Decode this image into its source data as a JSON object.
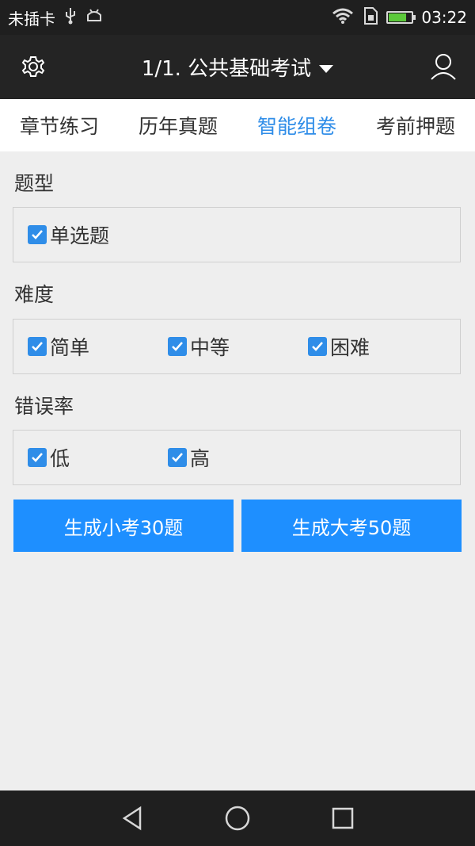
{
  "status_bar": {
    "carrier": "未插卡",
    "time": "03:22",
    "battery_level": 0.85,
    "icons": [
      "usb-icon",
      "android-icon",
      "wifi-icon",
      "sim-icon",
      "battery-icon"
    ]
  },
  "app_bar": {
    "title": "1/1. 公共基础考试",
    "icons": [
      "gear-icon",
      "dropdown-icon",
      "user-icon"
    ]
  },
  "tabs": [
    {
      "label": "章节练习",
      "active": false
    },
    {
      "label": "历年真题",
      "active": false
    },
    {
      "label": "智能组卷",
      "active": true
    },
    {
      "label": "考前押题",
      "active": false
    }
  ],
  "sections": {
    "type": {
      "title": "题型",
      "options": [
        {
          "label": "单选题",
          "checked": true
        }
      ]
    },
    "difficulty": {
      "title": "难度",
      "options": [
        {
          "label": "简单",
          "checked": true
        },
        {
          "label": "中等",
          "checked": true
        },
        {
          "label": "困难",
          "checked": true
        }
      ]
    },
    "error_rate": {
      "title": "错误率",
      "options": [
        {
          "label": "低",
          "checked": true
        },
        {
          "label": "高",
          "checked": true
        }
      ]
    }
  },
  "buttons": {
    "small_exam": "生成小考30题",
    "big_exam": "生成大考50题"
  },
  "colors": {
    "accent": "#2f8de8",
    "button": "#1e8fff",
    "app_bar": "#242424",
    "status_bar": "#1f1f1f",
    "background": "#eeeeee"
  },
  "nav": {
    "icons": [
      "back-icon",
      "home-icon",
      "recent-apps-icon"
    ]
  }
}
